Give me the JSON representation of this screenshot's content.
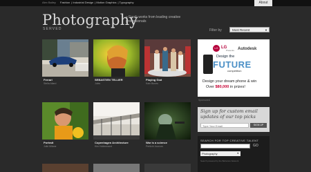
{
  "topbar": {
    "brand": "Alex Bailey",
    "sites": [
      "Fashion",
      "Industrial Design",
      "Motion Graphics",
      "Typography"
    ],
    "about": "About"
  },
  "header": {
    "logo": "Photography",
    "logo_sub": "SERVED",
    "tagline": "» Fresh works from leading creative professionals"
  },
  "filter": {
    "label": "Filter by",
    "value": "Most Recent"
  },
  "tiles": [
    {
      "title": "Ferrari",
      "author": "Stella Allard"
    },
    {
      "title": "SEBASTIEN TELLIER",
      "author": "Jules"
    },
    {
      "title": "Playing God",
      "author": "Kain Bones"
    },
    {
      "title": "Portrait",
      "author": "Julie Milane"
    },
    {
      "title": "Copenhagen Architecture",
      "author": "Kim Holtermand"
    },
    {
      "title": "War is a science",
      "author": "Pertichi Jourcos"
    }
  ],
  "ad": {
    "lg": "LG",
    "lg_text": "LG",
    "presents": "Presents",
    "autodesk": "Autodesk",
    "design": "Design the",
    "future": "FUTURE",
    "competition": "competition",
    "line1": "Design your dream phone & win",
    "line2_pre": "Over ",
    "line2_amount": "$80,000",
    "line2_post": " in prizes!",
    "sponsored": "Sponsored"
  },
  "signup": {
    "heading": "Sign up for custom email updates of our top picks",
    "email_placeholder": "Type Your Email",
    "button": "SIGN UP"
  },
  "talent": {
    "heading": "SEARCH FOR TOP CREATIVE TALENT",
    "go": "GO",
    "category": "Photography",
    "note": "Search powered by the Behance Network"
  }
}
